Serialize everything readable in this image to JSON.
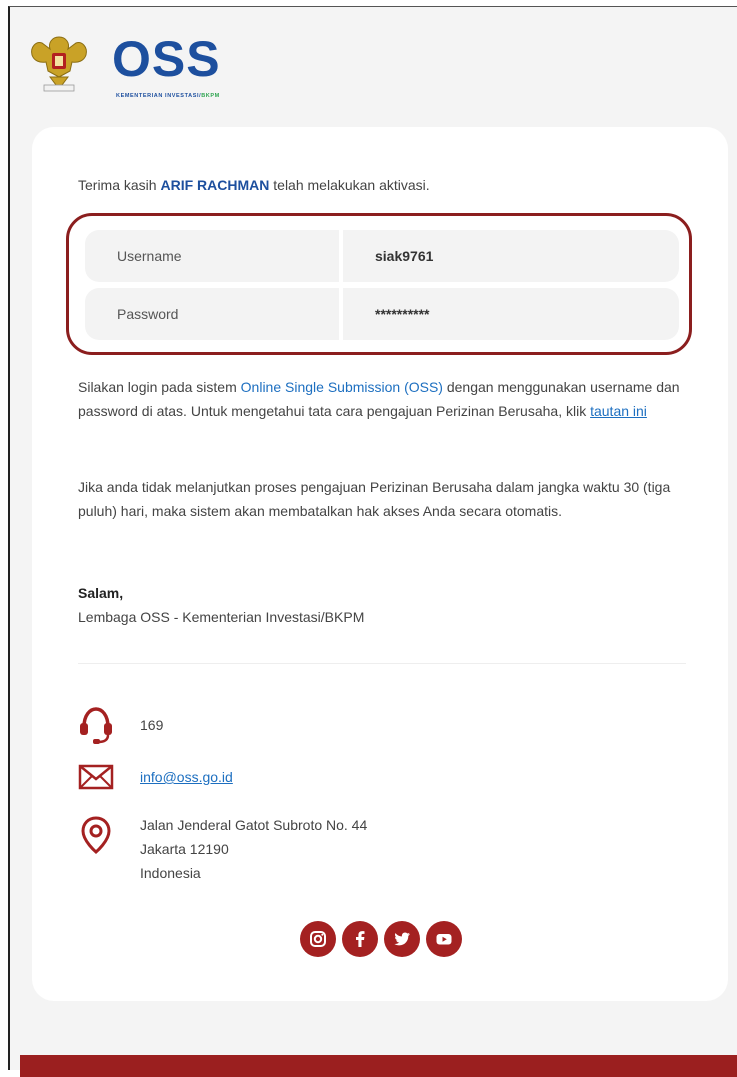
{
  "header": {
    "logo_text": "OSS",
    "logo_subtext_main": "KEMENTERIAN INVESTASI/",
    "logo_subtext_accent": "BKPM"
  },
  "message": {
    "thanks_prefix": "Terima kasih",
    "name": "ARIF RACHMAN",
    "thanks_suffix": "telah melakukan aktivasi."
  },
  "credentials": {
    "username_label": "Username",
    "username_value": "siak9761",
    "password_label": "Password",
    "password_value": "**********"
  },
  "paragraph1": {
    "before_link": "Silakan login pada sistem",
    "oss_link": "Online Single Submission (OSS)",
    "after_link": "dengan menggunakan username dan password di atas. Untuk mengetahui tata cara pengajuan Perizinan Berusaha, klik",
    "tautan_link": "tautan ini"
  },
  "paragraph2": "Jika anda tidak melanjutkan proses pengajuan Perizinan Berusaha dalam jangka waktu 30 (tiga puluh) hari, maka sistem akan membatalkan hak akses Anda secara otomatis.",
  "signature": {
    "greeting": "Salam,",
    "sender": "Lembaga OSS - Kementerian Investasi/BKPM"
  },
  "contact": {
    "phone": "169",
    "email": "info@oss.go.id",
    "address_line1": "Jalan Jenderal Gatot Subroto No. 44",
    "address_line2": "Jakarta 12190",
    "address_line3": "Indonesia"
  },
  "icons": {
    "phone": "headset-icon",
    "email": "envelope-icon",
    "address": "location-pin-icon",
    "social": [
      "instagram-icon",
      "facebook-icon",
      "twitter-icon",
      "youtube-icon"
    ]
  },
  "colors": {
    "brand_blue": "#1d4f9e",
    "accent_red": "#8b1e1e",
    "link_blue": "#1d6fc0",
    "footer_red": "#9b1f1f"
  }
}
